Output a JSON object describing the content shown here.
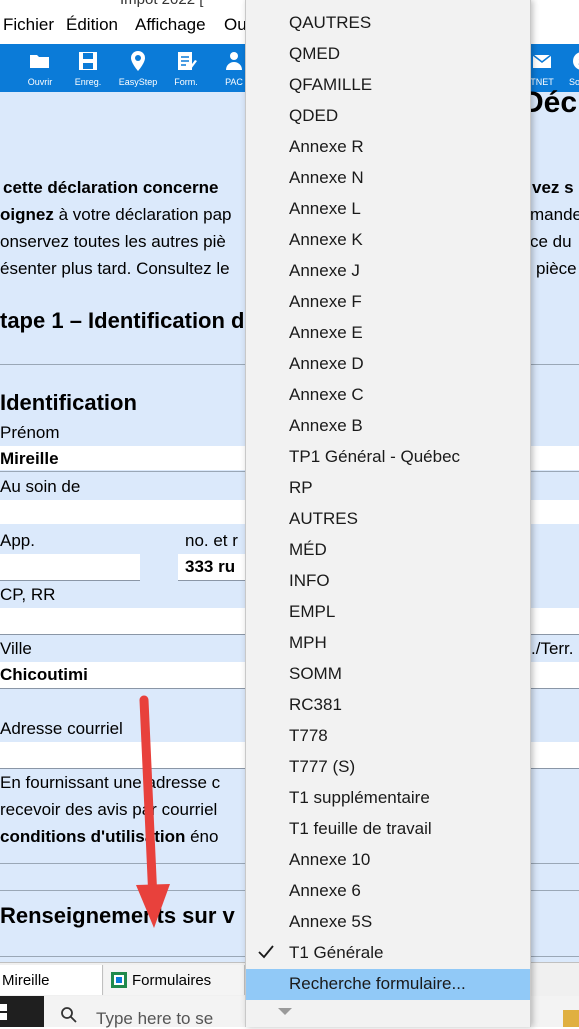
{
  "window": {
    "title_fragment": "Impot 2022 ["
  },
  "menubar": {
    "items": [
      "Fichier",
      "Édition",
      "Affichage",
      "Ou"
    ]
  },
  "toolbar": {
    "buttons": [
      {
        "label": "Ouvrir",
        "icon": "folder-icon"
      },
      {
        "label": "Enreg.",
        "icon": "save-icon"
      },
      {
        "label": "EasyStep",
        "icon": "pin-icon"
      },
      {
        "label": "Form.",
        "icon": "form-icon"
      },
      {
        "label": "PAC",
        "icon": "people-icon"
      },
      {
        "label": "TNET",
        "icon": "envelope-icon"
      },
      {
        "label": "Somm",
        "icon": "summary-icon"
      }
    ]
  },
  "form": {
    "heading_right": "Décla",
    "intro": {
      "line1": "cette déclaration concerne",
      "line1_right": "vez s",
      "line2_bold": "oignez",
      "line2_rest": " à votre déclaration pap",
      "line2_right": "mande",
      "line3": "onservez toutes les autres piè",
      "line3_right": "ce du",
      "line4": "ésenter plus tard. Consultez le",
      "line4_right": "pièce"
    },
    "step_title": "tape 1 – Identification d",
    "identification_title": "Identification",
    "prenom_label": "Prénom",
    "prenom_value": "Mireille",
    "au_soin_label": "Au soin de",
    "app_label": "App.",
    "no_rue_label": "no. et r",
    "no_rue_value": "333 ru",
    "cp_label": "CP, RR",
    "ville_label": "Ville",
    "ville_value": "Chicoutimi",
    "prov_label": "./Terr.",
    "courriel_label": "Adresse courriel",
    "note_line1": "En fournissant une adresse c",
    "note_line2": "recevoir des avis par courriel",
    "note_line3_bold": "conditions d'utilisation",
    "note_line3_rest": " éno",
    "renseignements_title": "Renseignements sur v"
  },
  "statusbar": {
    "tab1": "Mireille",
    "tab2": "Formulaires"
  },
  "taskbar": {
    "search_placeholder": "Type here to se"
  },
  "dropdown": {
    "items": [
      "QAUTRES",
      "QMED",
      "QFAMILLE",
      "QDED",
      "Annexe R",
      "Annexe N",
      "Annexe L",
      "Annexe K",
      "Annexe J",
      "Annexe F",
      "Annexe E",
      "Annexe D",
      "Annexe C",
      "Annexe B",
      "TP1 Général - Québec",
      "RP",
      "AUTRES",
      "MÉD",
      "INFO",
      "EMPL",
      "MPH",
      "SOMM",
      "RC381",
      "T778",
      "T777 (S)",
      "T1 supplémentaire",
      "T1 feuille de travail",
      "Annexe 10",
      "Annexe 6",
      "Annexe 5S",
      "T1 Générale",
      "Recherche formulaire..."
    ],
    "checked_item": "T1 Générale",
    "highlighted_item": "Recherche formulaire...",
    "scroll_arrow_icon": "chevron-down-icon"
  },
  "annotation": {
    "arrow_color": "#e8413c",
    "icon": "red-arrow-annotation"
  },
  "colors": {
    "toolbar": "#0b7bd8",
    "form_bg": "#dbe9fb",
    "menu_highlight": "#91c9f7"
  }
}
